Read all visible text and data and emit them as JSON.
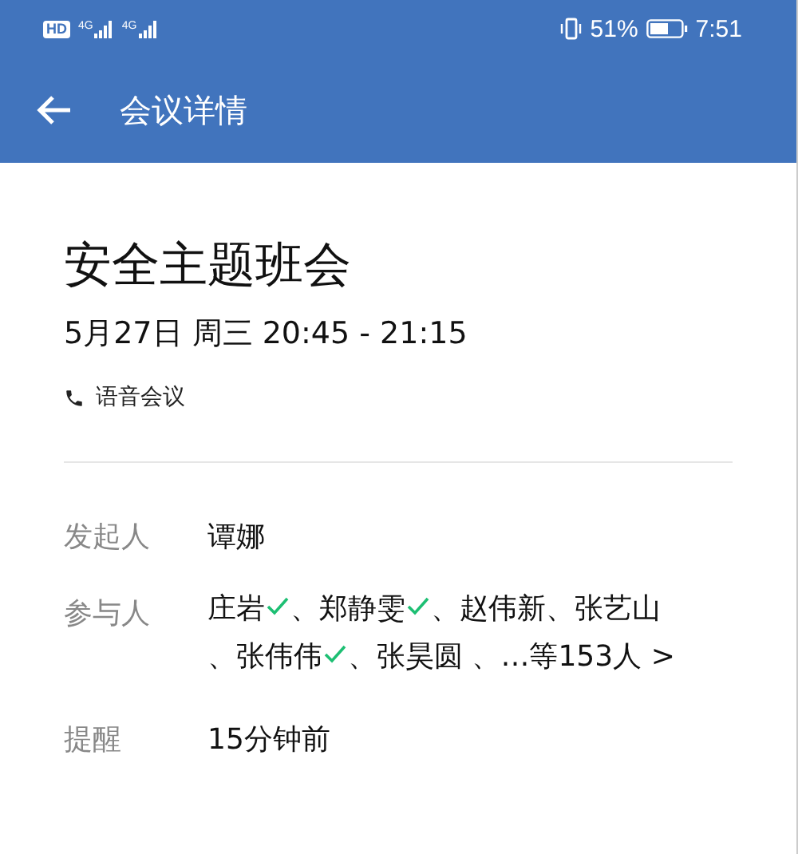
{
  "status_bar": {
    "hd": "HD",
    "networks": [
      "4G",
      "4G"
    ],
    "battery_percent": "51%",
    "time": "7:51"
  },
  "app_bar": {
    "title": "会议详情"
  },
  "meeting": {
    "title": "安全主题班会",
    "time": "5月27日 周三 20:45 - 21:15",
    "type": "语音会议"
  },
  "details": {
    "organizer_label": "发起人",
    "organizer": "谭娜",
    "participants_label": "参与人",
    "participants": [
      {
        "name": "庄岩",
        "accepted": true
      },
      {
        "name": "、郑静雯",
        "accepted": true
      },
      {
        "name": "、赵伟新",
        "accepted": false
      },
      {
        "name": "、张艺山",
        "accepted": false
      },
      {
        "name": "、张伟伟",
        "accepted": true
      },
      {
        "name": "、张昊圆",
        "accepted": false
      }
    ],
    "participants_more": "、…等153人 >",
    "reminder_label": "提醒",
    "reminder": "15分钟前"
  }
}
